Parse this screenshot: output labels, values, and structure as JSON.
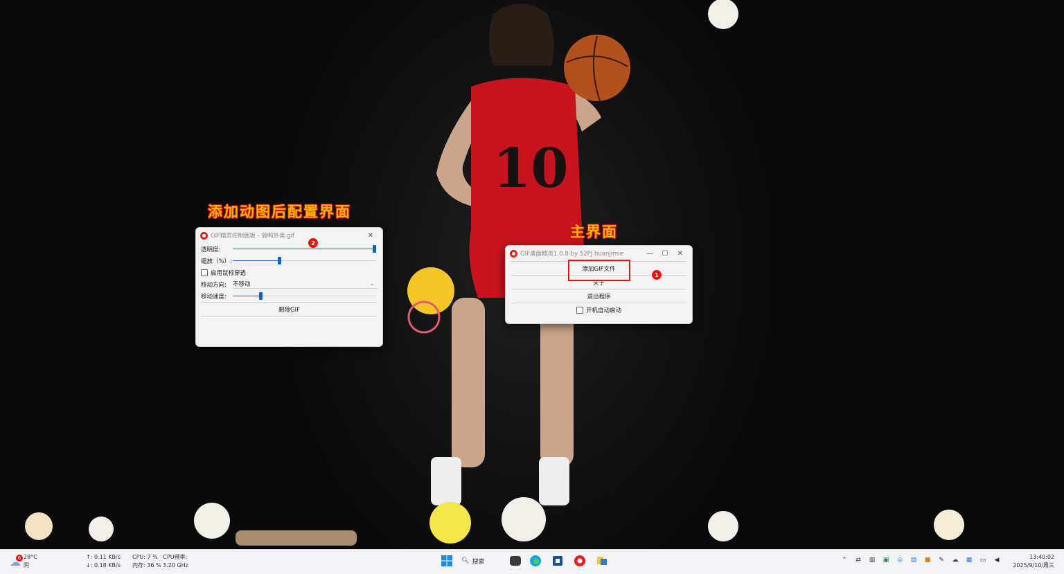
{
  "captions": {
    "config": "添加动图后配置界面",
    "main": "主界面"
  },
  "config_window": {
    "title": "GIF精灵控制面板 - 骑鸭外卖.gif",
    "badge": "2",
    "opacity_label": "透明度:",
    "opacity_value": 1.0,
    "scale_label": "缩放（%）:",
    "scale_value": 0.32,
    "click_through_label": "启用鼠标穿透",
    "direction_label": "移动方向:",
    "direction_value": "不移动",
    "speed_label": "移动速度:",
    "speed_value": 0.19,
    "delete_button": "删除GIF"
  },
  "main_window": {
    "title": "GIF桌面精灵1.0.8-by 52PJ huanjimie",
    "badge": "1",
    "add_button": "添加GIF文件",
    "about_button": "关于",
    "exit_button": "退出程序",
    "autostart_label": "开机自动启动"
  },
  "taskbar": {
    "weather_temp": "28°C",
    "weather_desc": "阴",
    "weather_alert": "6",
    "net_up": "↑: 0.11 KB/s",
    "net_down": "↓: 0.18 KB/s",
    "cpu": "CPU: 7 %",
    "cpu_freq_label": "CPU频率:",
    "mem": "内存: 36 %",
    "cpu_freq": "3.20 GHz",
    "search_label": "搜索",
    "time": "13:40:02",
    "date": "2025/9/10/周三"
  },
  "colors": {
    "accent": "#0a64c8",
    "badge": "#e8140f",
    "caption": "#ffb400",
    "jersey": "#c8141e"
  }
}
